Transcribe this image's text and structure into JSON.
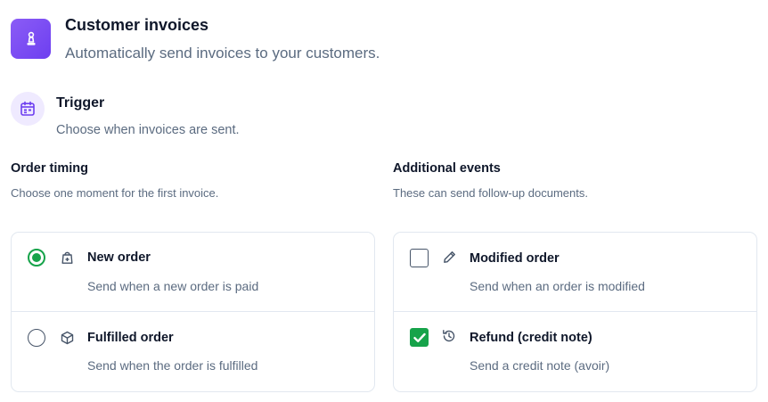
{
  "header": {
    "title": "Customer invoices",
    "subtitle": "Automatically send invoices to your customers.",
    "icon": "chess-pawn-icon",
    "accent": "#7c4dff"
  },
  "trigger": {
    "title": "Trigger",
    "description": "Choose when invoices are sent.",
    "icon": "calendar-icon"
  },
  "order_timing": {
    "heading": "Order timing",
    "description": "Choose one moment for the first invoice.",
    "options": [
      {
        "label": "New order",
        "description": "Send when a new order is paid",
        "selected": true,
        "icon": "shopping-bag-icon"
      },
      {
        "label": "Fulfilled order",
        "description": "Send when the order is fulfilled",
        "selected": false,
        "icon": "package-icon"
      }
    ]
  },
  "additional_events": {
    "heading": "Additional events",
    "description": "These can send follow-up documents.",
    "options": [
      {
        "label": "Modified order",
        "description": "Send when an order is modified",
        "checked": false,
        "icon": "pencil-icon"
      },
      {
        "label": "Refund (credit note)",
        "description": "Send a credit note (avoir)",
        "checked": true,
        "icon": "refund-icon"
      }
    ]
  },
  "colors": {
    "success": "#16a34a",
    "muted_text": "#5b6b80",
    "border": "#e2e8f0"
  }
}
